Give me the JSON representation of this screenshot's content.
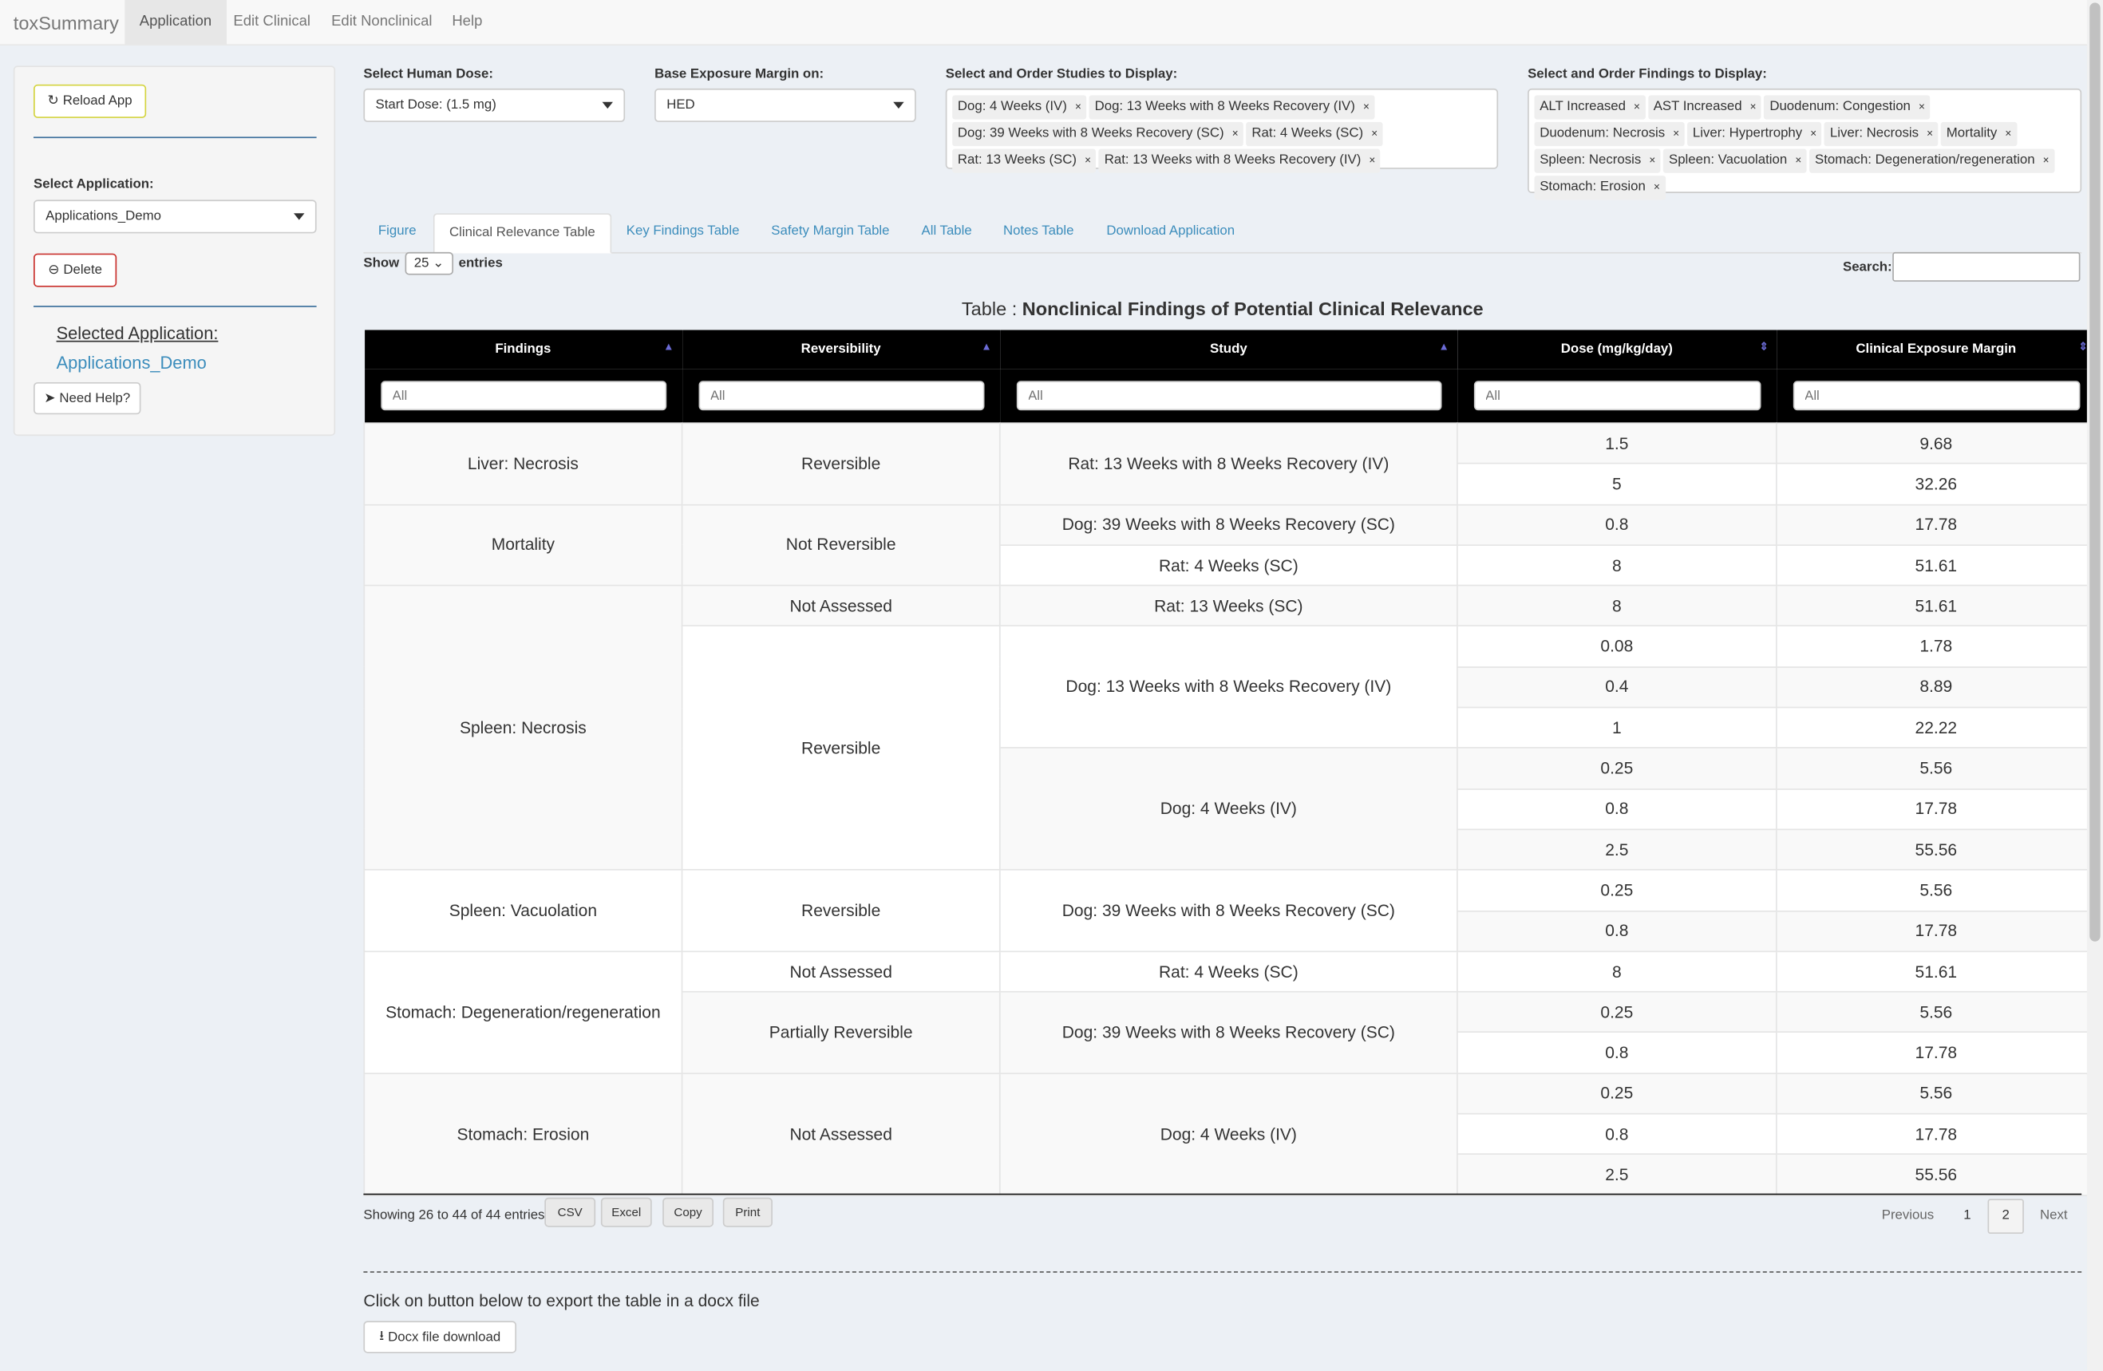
{
  "nav": {
    "brand": "toxSummary",
    "items": [
      "Application",
      "Edit Clinical",
      "Edit Nonclinical",
      "Help"
    ],
    "active": 0
  },
  "sidebar": {
    "reload": "Reload App",
    "select_app_label": "Select Application:",
    "select_app_value": "Applications_Demo",
    "delete": "Delete",
    "selected_label": "Selected Application:",
    "selected_value": "Applications_Demo",
    "help": "Need Help?"
  },
  "controls": {
    "dose_label": "Select Human Dose:",
    "dose_value": "Start Dose: (1.5 mg)",
    "margin_label": "Base Exposure Margin on:",
    "margin_value": "HED",
    "studies_label": "Select and Order Studies to Display:",
    "studies": [
      "Dog: 4 Weeks (IV)",
      "Dog: 13 Weeks with 8 Weeks Recovery (IV)",
      "Dog: 39 Weeks with 8 Weeks Recovery (SC)",
      "Rat: 4 Weeks (SC)",
      "Rat: 13 Weeks (SC)",
      "Rat: 13 Weeks with 8 Weeks Recovery (IV)"
    ],
    "findings_label": "Select and Order Findings to Display:",
    "findings": [
      "ALT Increased",
      "AST Increased",
      "Duodenum: Congestion",
      "Duodenum: Necrosis",
      "Liver: Hypertrophy",
      "Liver: Necrosis",
      "Mortality",
      "Spleen: Necrosis",
      "Spleen: Vacuolation",
      "Stomach: Degeneration/regeneration",
      "Stomach: Erosion"
    ]
  },
  "tabs": [
    "Figure",
    "Clinical Relevance Table",
    "Key Findings Table",
    "Safety Margin Table",
    "All Table",
    "Notes Table",
    "Download Application"
  ],
  "active_tab": 1,
  "table": {
    "show": "Show",
    "entries_value": "25",
    "entries": "entries",
    "search_label": "Search:",
    "title_prefix": "Table : ",
    "title": "Nonclinical Findings of Potential Clinical Relevance",
    "columns": [
      "Findings",
      "Reversibility",
      "Study",
      "Dose (mg/kg/day)",
      "Clinical Exposure Margin"
    ],
    "filter_placeholder": "All",
    "rows": [
      {
        "finding": [
          "Liver: Necrosis",
          2
        ],
        "rev": [
          "Reversible",
          2
        ],
        "study": [
          "Rat: 13 Weeks with 8 Weeks Recovery (IV)",
          2
        ],
        "dose": "1.5",
        "margin": "9.68"
      },
      {
        "dose": "5",
        "margin": "32.26"
      },
      {
        "finding": [
          "Mortality",
          2
        ],
        "rev": [
          "Not Reversible",
          2
        ],
        "study": [
          "Dog: 39 Weeks with 8 Weeks Recovery (SC)",
          1
        ],
        "dose": "0.8",
        "margin": "17.78"
      },
      {
        "study": [
          "Rat: 4 Weeks (SC)",
          1
        ],
        "dose": "8",
        "margin": "51.61"
      },
      {
        "finding": [
          "Spleen: Necrosis",
          7
        ],
        "rev": [
          "Not Assessed",
          1
        ],
        "study": [
          "Rat: 13 Weeks (SC)",
          1
        ],
        "dose": "8",
        "margin": "51.61"
      },
      {
        "rev": [
          "Reversible",
          6
        ],
        "study": [
          "Dog: 13 Weeks with 8 Weeks Recovery (IV)",
          3
        ],
        "dose": "0.08",
        "margin": "1.78"
      },
      {
        "dose": "0.4",
        "margin": "8.89"
      },
      {
        "dose": "1",
        "margin": "22.22"
      },
      {
        "study": [
          "Dog: 4 Weeks (IV)",
          3
        ],
        "dose": "0.25",
        "margin": "5.56"
      },
      {
        "dose": "0.8",
        "margin": "17.78"
      },
      {
        "dose": "2.5",
        "margin": "55.56"
      },
      {
        "finding": [
          "Spleen: Vacuolation",
          2
        ],
        "rev": [
          "Reversible",
          2
        ],
        "study": [
          "Dog: 39 Weeks with 8 Weeks Recovery (SC)",
          2
        ],
        "dose": "0.25",
        "margin": "5.56"
      },
      {
        "dose": "0.8",
        "margin": "17.78"
      },
      {
        "finding": [
          "Stomach: Degeneration/regeneration",
          3
        ],
        "rev": [
          "Not Assessed",
          1
        ],
        "study": [
          "Rat: 4 Weeks (SC)",
          1
        ],
        "dose": "8",
        "margin": "51.61"
      },
      {
        "rev": [
          "Partially Reversible",
          2
        ],
        "study": [
          "Dog: 39 Weeks with 8 Weeks Recovery (SC)",
          2
        ],
        "dose": "0.25",
        "margin": "5.56"
      },
      {
        "dose": "0.8",
        "margin": "17.78"
      },
      {
        "finding": [
          "Stomach: Erosion",
          3
        ],
        "rev": [
          "Not Assessed",
          3
        ],
        "study": [
          "Dog: 4 Weeks (IV)",
          3
        ],
        "dose": "0.25",
        "margin": "5.56"
      },
      {
        "dose": "0.8",
        "margin": "17.78"
      },
      {
        "dose": "2.5",
        "margin": "55.56"
      }
    ],
    "info": "Showing 26 to 44 of 44 entries",
    "buttons": [
      "CSV",
      "Excel",
      "Copy",
      "Print"
    ],
    "pagination": {
      "prev": "Previous",
      "pages": [
        "1",
        "2"
      ],
      "current": "2",
      "next": "Next"
    }
  },
  "export": {
    "text": "Click on button below to export the table in a docx file",
    "button": "Docx file download"
  }
}
